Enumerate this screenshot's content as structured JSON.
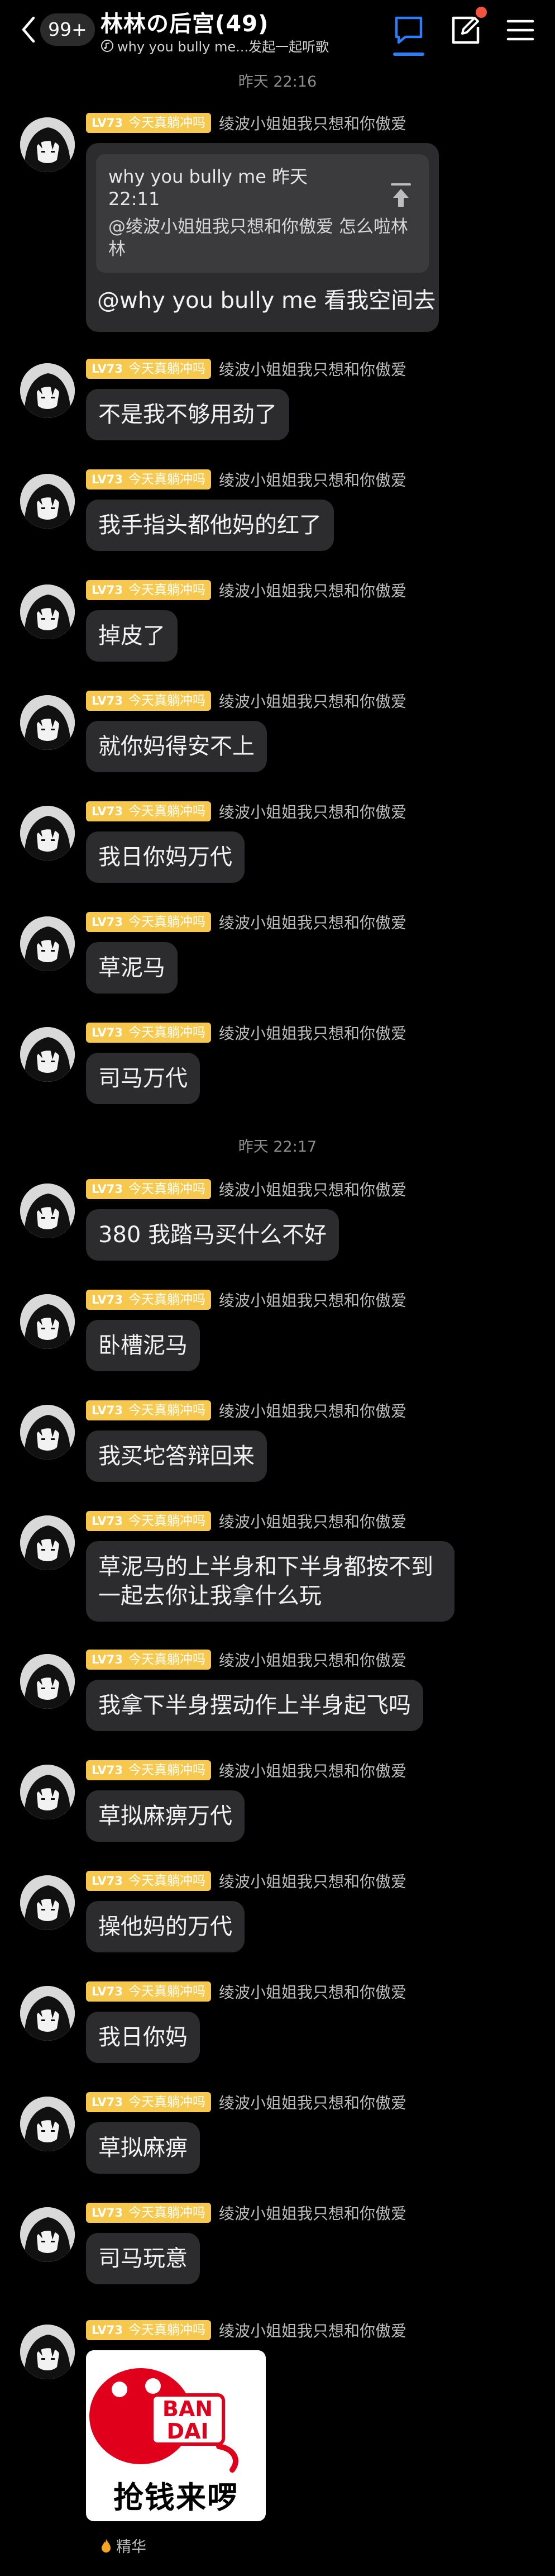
{
  "header": {
    "unread_count": "99+",
    "title": "林林の后宫(49)",
    "subtitle": "why you bully me...发起一起听歌"
  },
  "colors": {
    "background": "#000000",
    "bubble": "#2c2c2e",
    "level_badge": "#f6c84e",
    "accent_blue": "#2f7cf6",
    "notify_red": "#f0533e"
  },
  "sender": {
    "level": "LV73",
    "title": "今天真躺冲吗",
    "nickname": "绫波小姐姐我只想和你傲爱"
  },
  "time_separators": [
    "昨天 22:16",
    "昨天 22:17"
  ],
  "quote_message": {
    "quoted_header": "why you bully me 昨天 22:11",
    "quoted_text": "@绫波小姐姐我只想和你傲爱 怎么啦林林",
    "reply": "@why you bully me 看我空间去"
  },
  "messages": [
    "不是我不够用劲了",
    "我手指头都他妈的红了",
    "掉皮了",
    "就你妈得安不上",
    "我日你妈万代",
    "草泥马",
    "司马万代",
    "380 我踏马买什么不好",
    "卧槽泥马",
    "我买坨答辩回来",
    "草泥马的上半身和下半身都按不到一起去你让我拿什么玩",
    "我拿下半身摆动作上半身起飞吗",
    "草拟麻痹万代",
    "操他妈的万代",
    "我日你妈",
    "草拟麻痹",
    "司马玩意"
  ],
  "sticker": {
    "brand": "BANDAI",
    "caption": "抢钱来啰",
    "tag": "精华"
  }
}
